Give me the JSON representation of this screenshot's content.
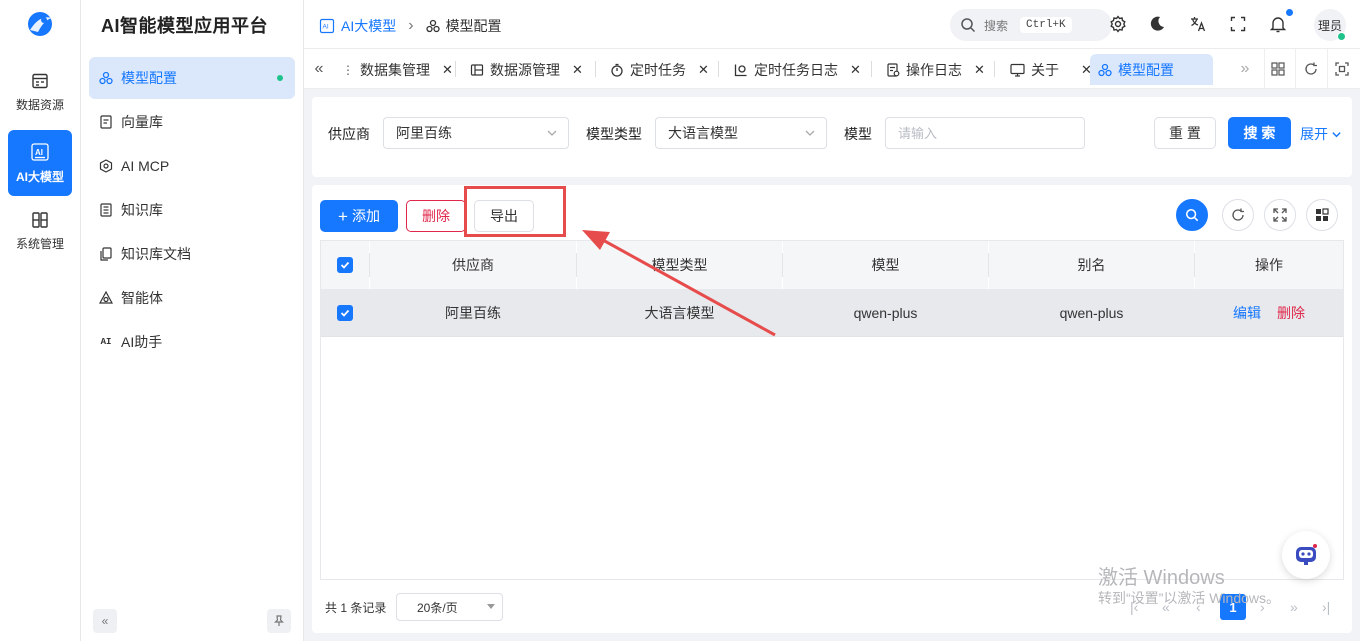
{
  "app": {
    "title": "AI智能模型应用平台"
  },
  "rail": [
    {
      "label": "数据资源",
      "icon": "database-icon"
    },
    {
      "label": "AI大模型",
      "icon": "ai-chip-icon",
      "active": true
    },
    {
      "label": "系统管理",
      "icon": "grid-settings-icon"
    }
  ],
  "submenu": [
    {
      "label": "模型配置",
      "icon": "model-nodes-icon",
      "active": true
    },
    {
      "label": "向量库",
      "icon": "doc-icon"
    },
    {
      "label": "AI MCP",
      "icon": "hexagon-icon"
    },
    {
      "label": "知识库",
      "icon": "book-icon"
    },
    {
      "label": "知识库文档",
      "icon": "files-icon"
    },
    {
      "label": "智能体",
      "icon": "agent-icon"
    },
    {
      "label": "AI助手",
      "icon": "ai-text-icon",
      "glyph": "AI"
    }
  ],
  "breadcrumb": {
    "root": "AI大模型",
    "current": "模型配置",
    "separator": "›"
  },
  "header": {
    "search_label": "搜索",
    "search_shortcut": "Ctrl+K",
    "avatar_text": "理员"
  },
  "tabs": [
    {
      "label": "数据集管理"
    },
    {
      "label": "数据源管理"
    },
    {
      "label": "定时任务"
    },
    {
      "label": "定时任务日志"
    },
    {
      "label": "操作日志"
    },
    {
      "label": "关于"
    },
    {
      "label": "模型配置",
      "active": true
    }
  ],
  "filter": {
    "supplier_label": "供应商",
    "supplier_value": "阿里百练",
    "model_type_label": "模型类型",
    "model_type_value": "大语言模型",
    "model_label": "模型",
    "model_placeholder": "请输入",
    "reset_label": "重 置",
    "search_label": "搜 索",
    "expand_label": "展开"
  },
  "toolbar": {
    "add_label": "添加",
    "delete_label": "删除",
    "export_label": "导出"
  },
  "table": {
    "columns": [
      "供应商",
      "模型类型",
      "模型",
      "别名",
      "操作"
    ],
    "rows": [
      {
        "supplier": "阿里百练",
        "model_type": "大语言模型",
        "model": "qwen-plus",
        "alias": "qwen-plus",
        "edit": "编辑",
        "delete": "删除",
        "checked": true
      }
    ]
  },
  "pager": {
    "total_text": "共 1 条记录",
    "page_size": "20条/页",
    "current_page": "1"
  },
  "watermark": {
    "line1": "激活 Windows",
    "line2": "转到“设置”以激活 Windows。"
  },
  "colors": {
    "primary": "#1677ff",
    "danger": "#e0264a",
    "annotation": "#e74c4c",
    "online": "#1ec28b"
  }
}
